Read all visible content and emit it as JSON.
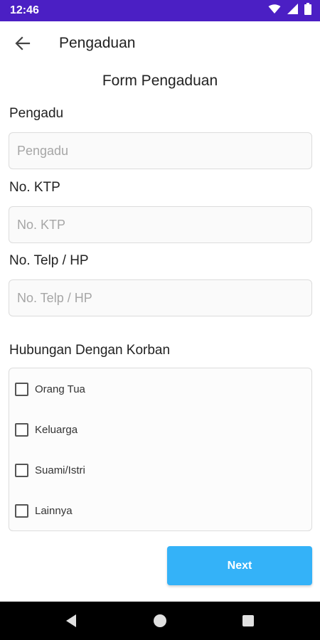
{
  "status_bar": {
    "time": "12:46",
    "icons": [
      "wifi-icon",
      "signal-icon",
      "battery-icon"
    ]
  },
  "app_bar": {
    "title": "Pengaduan",
    "back_icon": "arrow-back-icon"
  },
  "form": {
    "title": "Form Pengaduan",
    "fields": [
      {
        "label": "Pengadu",
        "placeholder": "Pengadu",
        "value": ""
      },
      {
        "label": "No. KTP",
        "placeholder": "No. KTP",
        "value": ""
      },
      {
        "label": "No. Telp / HP",
        "placeholder": "No. Telp / HP",
        "value": ""
      }
    ],
    "relationship": {
      "label": "Hubungan Dengan Korban",
      "options": [
        {
          "label": "Orang Tua",
          "checked": false
        },
        {
          "label": "Keluarga",
          "checked": false
        },
        {
          "label": "Suami/Istri",
          "checked": false
        },
        {
          "label": "Lainnya",
          "checked": false
        }
      ]
    },
    "next_label": "Next"
  },
  "colors": {
    "status_bar": "#4b1fc4",
    "button": "#34b2f8",
    "nav_bar": "#000000"
  },
  "nav_bar": {
    "icons": [
      "back-triangle-icon",
      "home-circle-icon",
      "recents-square-icon"
    ]
  }
}
